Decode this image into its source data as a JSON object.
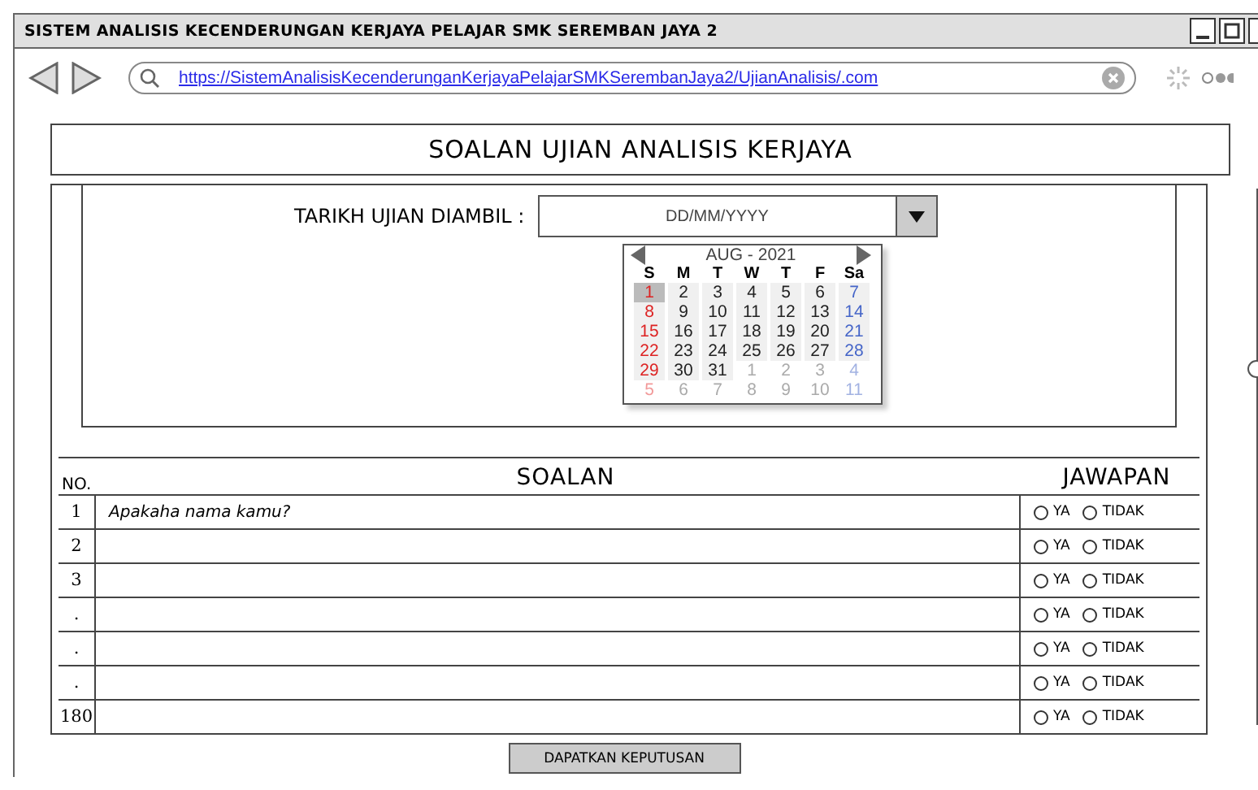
{
  "window": {
    "title": "SISTEM ANALISIS KECENDERUNGAN KERJAYA PELAJAR SMK SEREMBAN JAYA 2"
  },
  "browser": {
    "url": "https://SistemAnalisisKecenderunganKerjayaPelajarSMKSerembanJaya2/UjianAnalisis/.com"
  },
  "page_title": "SOALAN UJIAN ANALISIS KERJAYA",
  "date_field": {
    "label": "TARIKH UJIAN DIAMBIL :",
    "placeholder": "DD/MM/YYYY"
  },
  "calendar": {
    "month": "AUG - 2021",
    "weekdays": [
      "S",
      "M",
      "T",
      "W",
      "T",
      "F",
      "Sa"
    ],
    "days": [
      {
        "d": "1",
        "kind": "sun",
        "outside": false,
        "selected": true
      },
      {
        "d": "2",
        "kind": "day",
        "outside": false,
        "selected": false
      },
      {
        "d": "3",
        "kind": "day",
        "outside": false,
        "selected": false
      },
      {
        "d": "4",
        "kind": "day",
        "outside": false,
        "selected": false
      },
      {
        "d": "5",
        "kind": "day",
        "outside": false,
        "selected": false
      },
      {
        "d": "6",
        "kind": "day",
        "outside": false,
        "selected": false
      },
      {
        "d": "7",
        "kind": "sat",
        "outside": false,
        "selected": false
      },
      {
        "d": "8",
        "kind": "sun",
        "outside": false,
        "selected": false
      },
      {
        "d": "9",
        "kind": "day",
        "outside": false,
        "selected": false
      },
      {
        "d": "10",
        "kind": "day",
        "outside": false,
        "selected": false
      },
      {
        "d": "11",
        "kind": "day",
        "outside": false,
        "selected": false
      },
      {
        "d": "12",
        "kind": "day",
        "outside": false,
        "selected": false
      },
      {
        "d": "13",
        "kind": "day",
        "outside": false,
        "selected": false
      },
      {
        "d": "14",
        "kind": "sat",
        "outside": false,
        "selected": false
      },
      {
        "d": "15",
        "kind": "sun",
        "outside": false,
        "selected": false
      },
      {
        "d": "16",
        "kind": "day",
        "outside": false,
        "selected": false
      },
      {
        "d": "17",
        "kind": "day",
        "outside": false,
        "selected": false
      },
      {
        "d": "18",
        "kind": "day",
        "outside": false,
        "selected": false
      },
      {
        "d": "19",
        "kind": "day",
        "outside": false,
        "selected": false
      },
      {
        "d": "20",
        "kind": "day",
        "outside": false,
        "selected": false
      },
      {
        "d": "21",
        "kind": "sat",
        "outside": false,
        "selected": false
      },
      {
        "d": "22",
        "kind": "sun",
        "outside": false,
        "selected": false
      },
      {
        "d": "23",
        "kind": "day",
        "outside": false,
        "selected": false
      },
      {
        "d": "24",
        "kind": "day",
        "outside": false,
        "selected": false
      },
      {
        "d": "25",
        "kind": "day",
        "outside": false,
        "selected": false
      },
      {
        "d": "26",
        "kind": "day",
        "outside": false,
        "selected": false
      },
      {
        "d": "27",
        "kind": "day",
        "outside": false,
        "selected": false
      },
      {
        "d": "28",
        "kind": "sat",
        "outside": false,
        "selected": false
      },
      {
        "d": "29",
        "kind": "sun",
        "outside": false,
        "selected": false
      },
      {
        "d": "30",
        "kind": "day",
        "outside": false,
        "selected": false
      },
      {
        "d": "31",
        "kind": "day",
        "outside": false,
        "selected": false
      },
      {
        "d": "1",
        "kind": "day",
        "outside": true,
        "selected": false
      },
      {
        "d": "2",
        "kind": "day",
        "outside": true,
        "selected": false
      },
      {
        "d": "3",
        "kind": "day",
        "outside": true,
        "selected": false
      },
      {
        "d": "4",
        "kind": "sat",
        "outside": true,
        "selected": false
      },
      {
        "d": "5",
        "kind": "sun",
        "outside": true,
        "selected": false
      },
      {
        "d": "6",
        "kind": "day",
        "outside": true,
        "selected": false
      },
      {
        "d": "7",
        "kind": "day",
        "outside": true,
        "selected": false
      },
      {
        "d": "8",
        "kind": "day",
        "outside": true,
        "selected": false
      },
      {
        "d": "9",
        "kind": "day",
        "outside": true,
        "selected": false
      },
      {
        "d": "10",
        "kind": "day",
        "outside": true,
        "selected": false
      },
      {
        "d": "11",
        "kind": "sat",
        "outside": true,
        "selected": false
      }
    ]
  },
  "table": {
    "columns": [
      "NO.",
      "SOALAN",
      "JAWAPAN"
    ],
    "rows": [
      {
        "no": "1",
        "question": "Apakaha nama kamu?",
        "options": [
          {
            "label": "YA",
            "selected": false
          },
          {
            "label": "TIDAK",
            "selected": false
          }
        ]
      },
      {
        "no": "2",
        "options": [
          {
            "label": "YA",
            "selected": false
          },
          {
            "label": "TIDAK",
            "selected": false
          }
        ]
      },
      {
        "no": "3",
        "options": [
          {
            "label": "YA",
            "selected": false
          },
          {
            "label": "TIDAK",
            "selected": false
          }
        ]
      },
      {
        "no": ".",
        "options": [
          {
            "label": "YA",
            "selected": false
          },
          {
            "label": "TIDAK",
            "selected": false
          }
        ]
      },
      {
        "no": ".",
        "options": [
          {
            "label": "YA",
            "selected": false
          },
          {
            "label": "TIDAK",
            "selected": false
          }
        ]
      },
      {
        "no": ".",
        "options": [
          {
            "label": "YA",
            "selected": false
          },
          {
            "label": "TIDAK",
            "selected": false
          }
        ]
      },
      {
        "no": "180",
        "options": [
          {
            "label": "YA",
            "selected": false
          },
          {
            "label": "TIDAK",
            "selected": false
          }
        ]
      }
    ]
  },
  "submit_button": "DAPATKAN KEPUTUSAN"
}
